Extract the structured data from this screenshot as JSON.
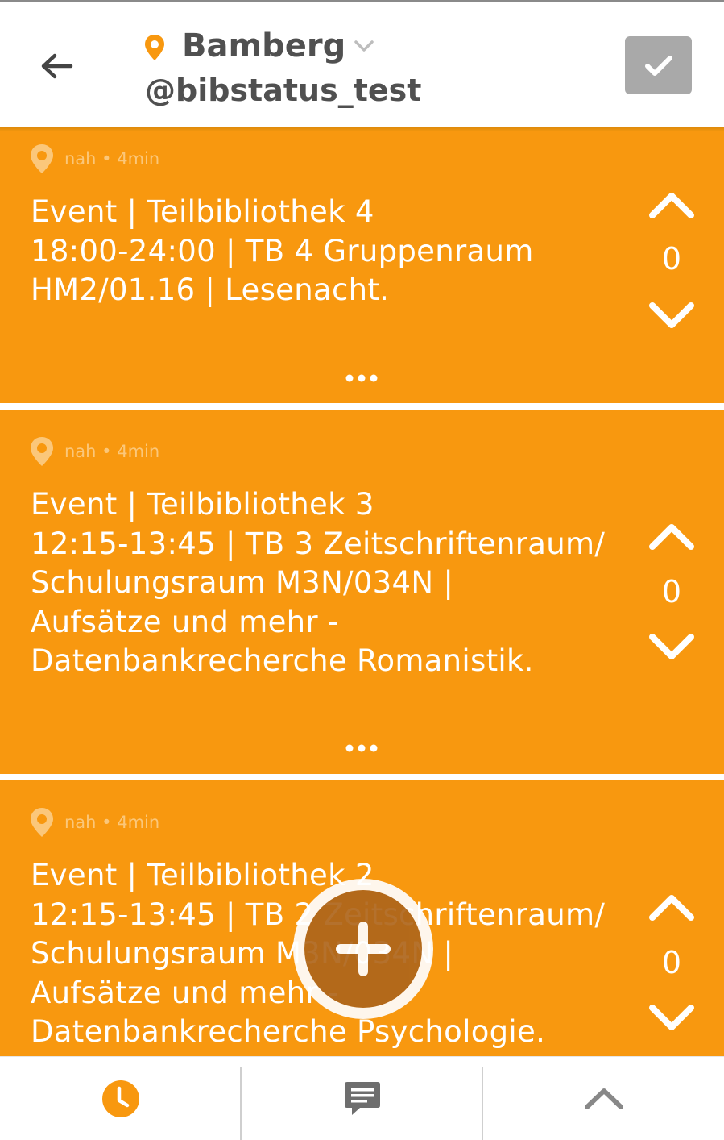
{
  "header": {
    "city": "Bamberg",
    "handle": "@bibstatus_test",
    "icons": {
      "back": "arrow-left-icon",
      "location": "map-pin-icon",
      "caret": "chevron-down-icon",
      "confirm": "checkmark-icon"
    }
  },
  "posts": [
    {
      "meta": "nah • 4min",
      "text": "Event | Teilbibliothek 4\n18:00-24:00 | TB 4 Gruppenraum\nHM2/01.16 | Lesenacht.",
      "votes": "0"
    },
    {
      "meta": "nah • 4min",
      "text": "Event | Teilbibliothek 3\n12:15-13:45 | TB 3 Zeitschriftenraum/\nSchulungsraum M3N/034N |\nAufsätze und mehr -\nDatenbankrecherche Romanistik.",
      "votes": "0"
    },
    {
      "meta": "nah • 4min",
      "text": "Event | Teilbibliothek 2\n12:15-13:45 | TB 2 Zeitschriftenraum/\nSchulungsraum M3N/034N |\nAufsätze und mehr -\nDatenbankrecherche Psychologie.",
      "votes": "0"
    }
  ],
  "fab": {
    "icon": "plus-icon"
  },
  "bottom_nav": [
    {
      "icon": "clock-icon",
      "active": true
    },
    {
      "icon": "comment-icon",
      "active": false
    },
    {
      "icon": "chevron-up-icon",
      "active": false
    }
  ],
  "colors": {
    "accent": "#f8980f",
    "header_text": "#505050",
    "meta_text": "#fbc77a",
    "button_gray": "#a9a9a9"
  }
}
